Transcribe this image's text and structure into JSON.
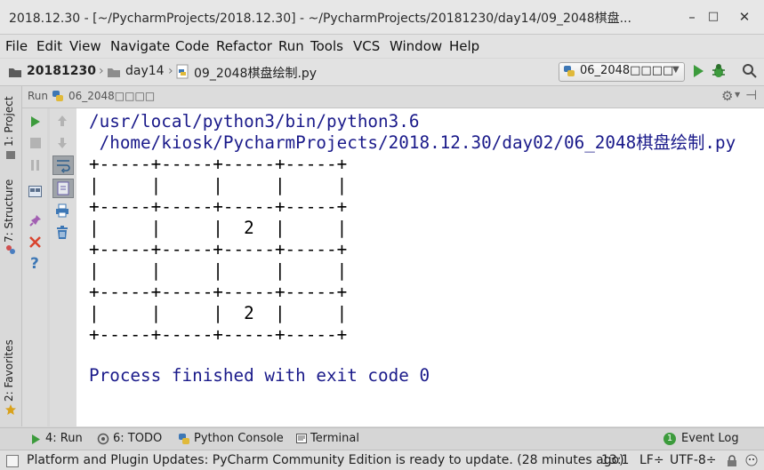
{
  "window": {
    "title": "2018.12.30 - [~/PycharmProjects/2018.12.30] - ~/PycharmProjects/20181230/day14/09_2048棋盘...",
    "minimize_glyph": "–",
    "maximize_glyph": "□",
    "close_glyph": "✕"
  },
  "menu": [
    "File",
    "Edit",
    "View",
    "Navigate",
    "Code",
    "Refactor",
    "Run",
    "Tools",
    "VCS",
    "Window",
    "Help"
  ],
  "breadcrumb": [
    "20181230",
    "day14",
    "09_2048棋盘绘制.py"
  ],
  "run_config": {
    "label": "06_2048□□□□"
  },
  "left_tabs": [
    "1: Project",
    "7: Structure",
    "2: Favorites"
  ],
  "run_panel": {
    "label": "Run",
    "config": "06_2048□□□□"
  },
  "console": {
    "path_lines": [
      "/usr/local/python3/bin/python3.6",
      " /home/kiosk/PycharmProjects/2018.12.30/day02/06_2048棋盘绘制.py"
    ],
    "board_lines": [
      "+-----+-----+-----+-----+",
      "|     |     |     |     |",
      "+-----+-----+-----+-----+",
      "|     |     |  2  |     |",
      "+-----+-----+-----+-----+",
      "|     |     |     |     |",
      "+-----+-----+-----+-----+",
      "|     |     |  2  |     |",
      "+-----+-----+-----+-----+"
    ],
    "exit_message": "Process finished with exit code 0"
  },
  "bottom_tabs": {
    "run": "4: Run",
    "todo": "6: TODO",
    "python_console": "Python Console",
    "terminal": "Terminal",
    "event_log": "Event Log",
    "event_count": "1"
  },
  "status": {
    "message": "Platform and Plugin Updates: PyCharm Community Edition is ready to update. (28 minutes ago)",
    "position": "13:1",
    "line_sep": "LF÷",
    "encoding": "UTF-8÷"
  },
  "colors": {
    "run_green": "#3c9b3c",
    "console_blue": "#1a1a8a",
    "python_blue": "#3d77b5",
    "python_yellow": "#e0b93a"
  }
}
